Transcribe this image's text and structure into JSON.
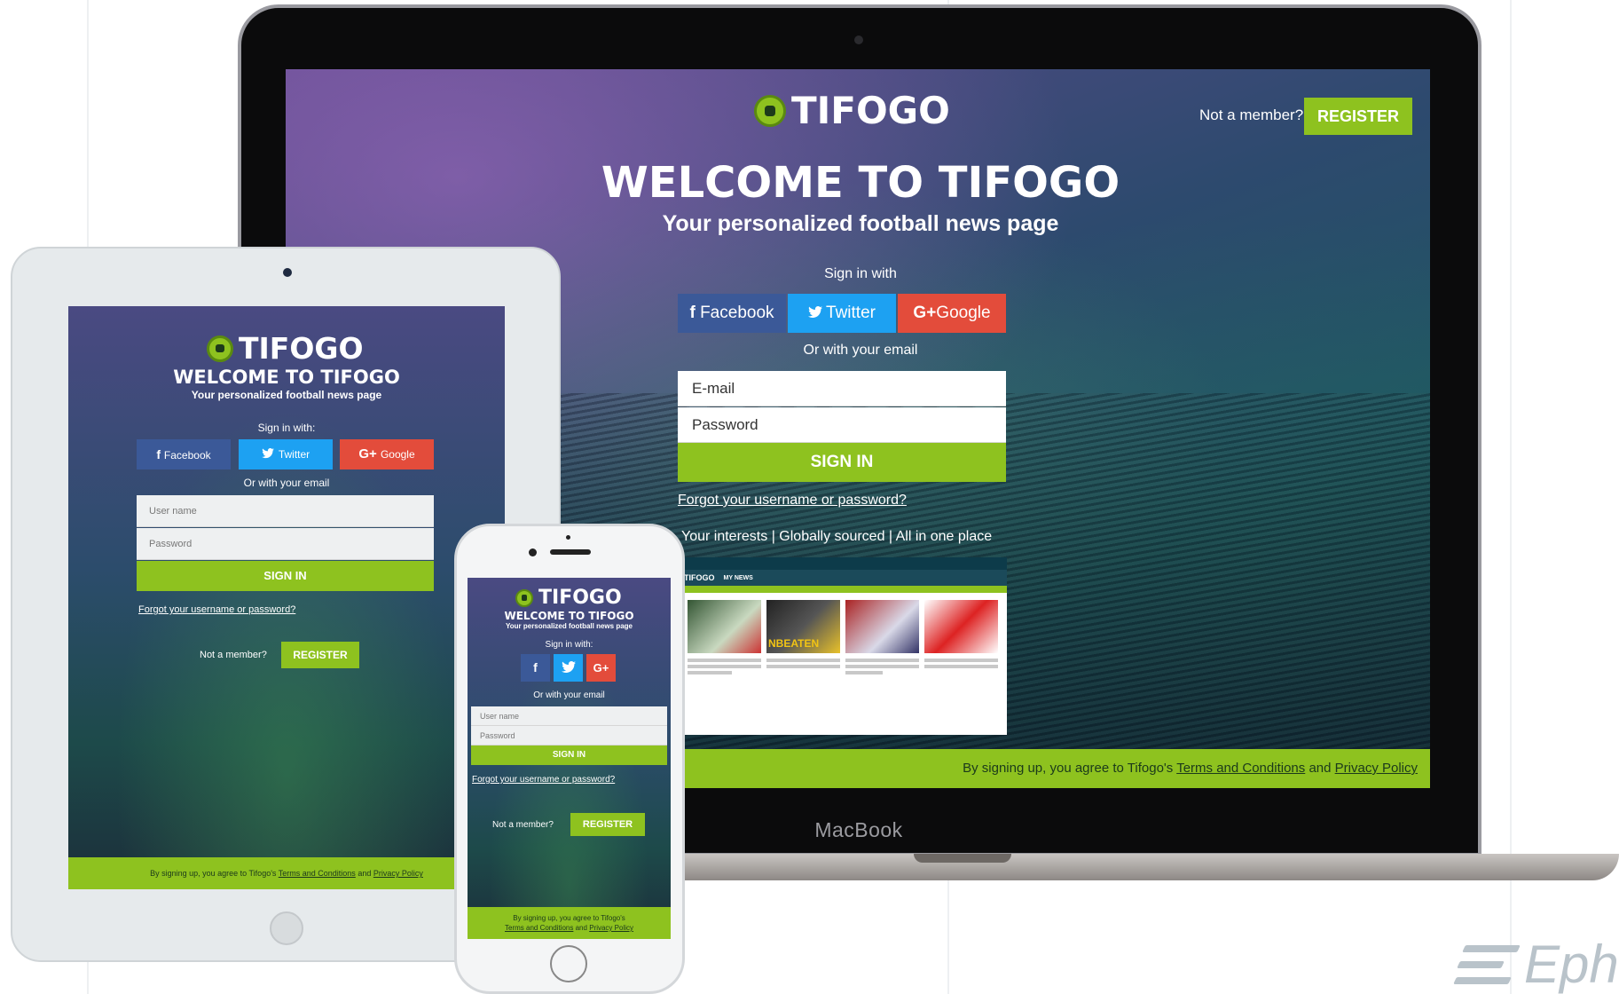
{
  "brand": {
    "name": "TIFOGO",
    "accent_color": "#8ec21f",
    "facebook_color": "#3b5998",
    "twitter_color": "#1da1f2",
    "google_color": "#e34c3b"
  },
  "laptop": {
    "device_label": "MacBook",
    "header": {
      "not_member_text": "Not a member?",
      "register_label": "REGISTER"
    },
    "title": "WELCOME TO TIFOGO",
    "subtitle": "Your personalized football news page",
    "sign_in_with": "Sign in with",
    "social": {
      "facebook": "Facebook",
      "twitter": "Twitter",
      "google": "Google"
    },
    "or_with_email": "Or with your email",
    "email_placeholder": "E-mail",
    "password_placeholder": "Password",
    "signin_label": "SIGN IN",
    "forgot_link": "Forgot your username or password?",
    "tagline": "Your interests | Globally sourced | All in one place",
    "preview": {
      "logo": "TIFOGO",
      "nav": "MY NEWS",
      "headline": "NBEATEN"
    },
    "footer": {
      "prefix": "By signing up, you agree to Tifogo's",
      "terms": "Terms and Conditions",
      "and": "and",
      "privacy": "Privacy Policy"
    }
  },
  "tablet": {
    "title": "WELCOME TO TIFOGO",
    "subtitle": "Your personalized football news page",
    "sign_in_with": "Sign in with:",
    "social": {
      "facebook": "Facebook",
      "twitter": "Twitter",
      "google": "Google"
    },
    "or_with_email": "Or with your email",
    "username_placeholder": "User name",
    "password_placeholder": "Password",
    "signin_label": "SIGN IN",
    "forgot_link": "Forgot your username or password?",
    "not_member_text": "Not a member?",
    "register_label": "REGISTER",
    "footer": {
      "prefix": "By signing up, you agree to Tifogo's",
      "terms": "Terms and Conditions",
      "and": "and",
      "privacy": "Privacy Policy"
    }
  },
  "phone": {
    "title": "WELCOME TO TIFOGO",
    "subtitle": "Your personalized football news page",
    "sign_in_with": "Sign in with:",
    "social": {
      "facebook": "f",
      "google": "G+"
    },
    "or_with_email": "Or with your email",
    "username_placeholder": "User name",
    "password_placeholder": "Password",
    "signin_label": "SIGN IN",
    "forgot_link": "Forgot your username or password?",
    "not_member_text": "Not a member?",
    "register_label": "REGISTER",
    "footer": {
      "prefix": "By signing up, you agree to Tifogo's",
      "terms": "Terms and Conditions",
      "and": "and",
      "privacy": "Privacy Policy"
    }
  },
  "watermark": {
    "text": "Eph"
  }
}
